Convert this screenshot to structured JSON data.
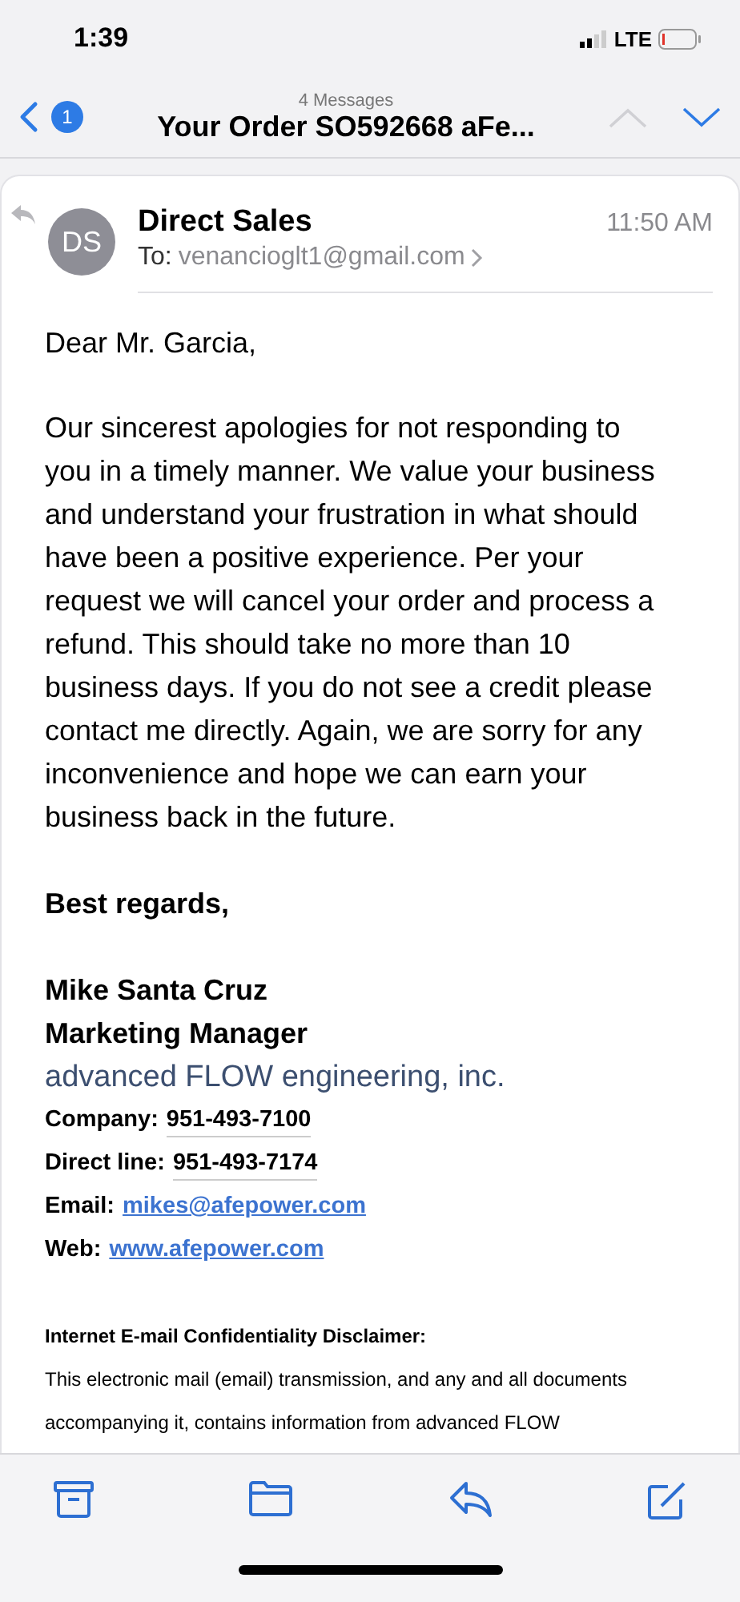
{
  "status_bar": {
    "time": "1:39",
    "network": "LTE"
  },
  "nav": {
    "unread_count": "1",
    "messages_count": "4 Messages",
    "subject": "Your Order SO592668 aFe..."
  },
  "message": {
    "sender_initials": "DS",
    "sender": "Direct Sales",
    "to_label": "To:",
    "to_address": "venancioglt1@gmail.com",
    "time": "11:50 AM",
    "greeting": "Dear Mr. Garcia,",
    "body_lines": [
      "Our sincerest apologies for not responding to",
      "you in a timely manner. We value your business",
      "and understand your frustration in what should",
      "have been a positive experience. Per your",
      "request we will cancel your order and process a",
      "refund. This should take no more than 10",
      "business days. If you do not see a credit please",
      "contact me directly. Again, we are sorry for any",
      "inconvenience and hope we can earn your",
      "business back in the future."
    ],
    "closing": "Best regards,",
    "signature": {
      "name": "Mike Santa Cruz",
      "title": "Marketing Manager",
      "company": "advanced FLOW engineering, inc."
    },
    "contacts": [
      {
        "label": "Company:",
        "value": "951-493-7100",
        "kind": "phone"
      },
      {
        "label": "Direct line:",
        "value": "951-493-7174",
        "kind": "phone"
      },
      {
        "label": "Email:",
        "value": "mikes@afepower.com",
        "kind": "link"
      },
      {
        "label": "Web:",
        "value": "www.afepower.com",
        "kind": "link"
      }
    ],
    "disclaimer_title": "Internet E-mail Confidentiality Disclaimer:",
    "disclaimer_lines": [
      "This electronic mail (email) transmission, and any and all documents",
      "accompanying it, contains information from advanced FLOW"
    ]
  }
}
